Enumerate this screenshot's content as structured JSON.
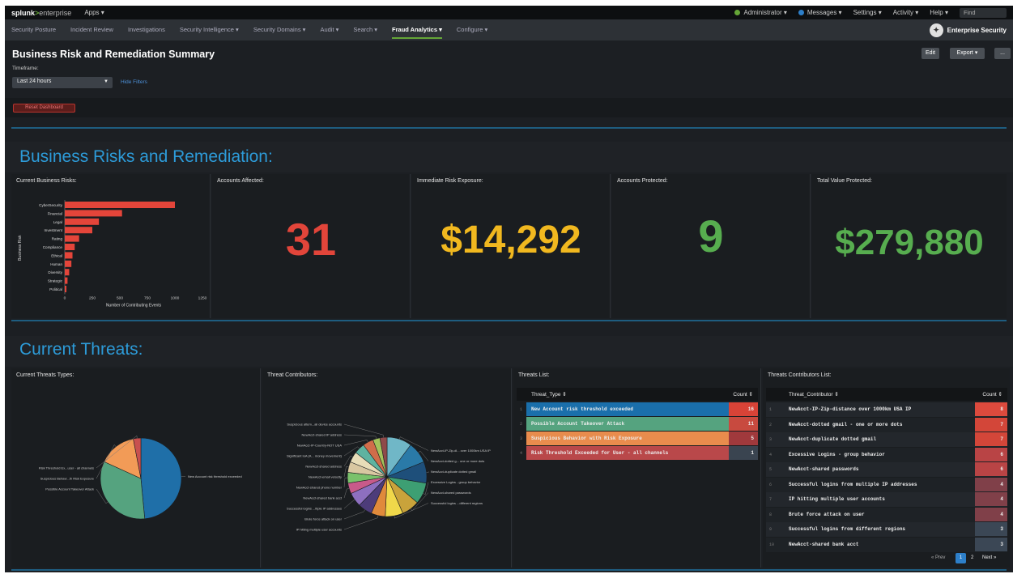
{
  "topbar": {
    "logo": "splunk",
    "logo_gt": ">",
    "logo_suffix": "enterprise",
    "apps": "Apps ▾",
    "administrator": "Administrator ▾",
    "messages": "Messages ▾",
    "settings": "Settings ▾",
    "activity": "Activity ▾",
    "help": "Help ▾",
    "find_placeholder": "Find"
  },
  "nav": {
    "items": [
      {
        "label": "Security Posture"
      },
      {
        "label": "Incident Review"
      },
      {
        "label": "Investigations"
      },
      {
        "label": "Security Intelligence ▾"
      },
      {
        "label": "Security Domains ▾"
      },
      {
        "label": "Audit ▾"
      },
      {
        "label": "Search ▾"
      },
      {
        "label": "Fraud Analytics ▾"
      },
      {
        "label": "Configure ▾"
      }
    ],
    "active_index": 7,
    "app_name": "Enterprise Security"
  },
  "header": {
    "title": "Business Risk and Remediation Summary",
    "timeframe_label": "Timeframe:",
    "timeframe_value": "Last 24 hours",
    "hide_filters": "Hide Filters",
    "edit": "Edit",
    "export": "Export ▾",
    "more": "..."
  },
  "reset_button": "Reset Dashboard",
  "section1": {
    "title": "Business Risks and Remediation:",
    "risk_chart_title": "Current Business Risks:",
    "accounts_affected_title": "Accounts Affected:",
    "accounts_affected": "31",
    "risk_exposure_title": "Immediate Risk Exposure:",
    "risk_exposure": "$14,292",
    "accounts_protected_title": "Accounts Protected:",
    "accounts_protected": "9",
    "value_protected_title": "Total Value Protected:",
    "value_protected": "$279,880"
  },
  "chart_data": [
    {
      "type": "bar",
      "orientation": "horizontal",
      "categories": [
        "CyberSecurity",
        "Financial",
        "Legal",
        "Investment",
        "Rating",
        "Compliance",
        "Ethical",
        "Human",
        "Diversity",
        "Strategic",
        "Political"
      ],
      "values": [
        1000,
        520,
        310,
        250,
        130,
        90,
        70,
        60,
        40,
        25,
        15
      ],
      "xlabel": "Number of Contributing Events",
      "ylabel": "Business Risk",
      "xticks": [
        "0",
        "250",
        "500",
        "750",
        "1000",
        "1250"
      ],
      "xlim": [
        0,
        1250
      ],
      "color": "#e4453a"
    },
    {
      "type": "pie",
      "title": "Current Threats Types:",
      "labels": [
        "New Account risk threshold exceeded",
        "Possible Account Takeover Attack",
        "Suspicious Behavi...th Risk Exposure",
        "Risk Threshold Ex...user - all channels"
      ],
      "values": [
        16,
        11,
        5,
        1
      ],
      "colors": [
        "#1f6fa8",
        "#55a37f",
        "#f29b57",
        "#c8504f"
      ]
    },
    {
      "type": "pie",
      "title": "Threat Contributors:",
      "labels": [
        "NewAcct-IP-Zip-dl... over 1000km USA IP",
        "NewAcct-dotted g... one or more dots",
        "NewAcct-duplicate dotted gmail",
        "Excessive Logins - group behavior",
        "NewAcct-shared passwords",
        "Successful logins ...different regions",
        "IP hitting multiple user accounts",
        "Brute force attack on user",
        "Successful logins ...ltiple IP addresses",
        "NewAcct-shared bank acct",
        "NewAcct-shared phone number",
        "NewAcct-email velocity",
        "NewAcct-shared address",
        "Significant IoA (A... money movement)",
        "NewAcct-IP-Country-NOT USA",
        "NewAcct-shared IP address",
        "Suspicious attem...all device accounts"
      ],
      "values": [
        7,
        6,
        6,
        6,
        5,
        5,
        4,
        4,
        4,
        3,
        3,
        3,
        3,
        3,
        3,
        2,
        2
      ],
      "colors": [
        "#70b7c7",
        "#2a7aa8",
        "#1e4f7a",
        "#3d9f73",
        "#c9a33b",
        "#f0d84a",
        "#e08a3b",
        "#4d3c7a",
        "#8d6fbf",
        "#c85a8a",
        "#7ac16b",
        "#d9c7a1",
        "#e8ddb8",
        "#5fb3a0",
        "#d16d4a",
        "#a4c35b",
        "#8f4a4a"
      ]
    }
  ],
  "section2": {
    "title": "Current Threats:",
    "threats_list_title": "Threats List:",
    "contrib_list_title": "Threats Contributors List:"
  },
  "threats_table": {
    "col1": "Threat_Type ⇕",
    "col2": "Count ⇕",
    "rows": [
      {
        "idx": "1",
        "name": "New Account risk threshold exceeded",
        "count": "16",
        "row_color": "#1a6fab",
        "count_color": "#d84337"
      },
      {
        "idx": "2",
        "name": "Possible Account Takeover Attack",
        "count": "11",
        "row_color": "#55a37f",
        "count_color": "#c84a3f"
      },
      {
        "idx": "3",
        "name": "Suspicious Behavior with Risk Exposure",
        "count": "5",
        "row_color": "#e98c4d",
        "count_color": "#a0393c"
      },
      {
        "idx": "4",
        "name": "Risk Threshold Exceeded for User - all channels",
        "count": "1",
        "row_color": "#b9484a",
        "count_color": "#3a4450"
      }
    ]
  },
  "contrib_table": {
    "col1": "Threat_Contributor ⇕",
    "col2": "Count ⇕",
    "rows": [
      {
        "idx": "1",
        "name": "NewAcct-IP-Zip-distance over 1000km USA IP",
        "count": "8",
        "count_color": "#dc4a3d"
      },
      {
        "idx": "2",
        "name": "NewAcct-dotted gmail - one or more dots",
        "count": "7",
        "count_color": "#d34639"
      },
      {
        "idx": "3",
        "name": "NewAcct-duplicate dotted gmail",
        "count": "7",
        "count_color": "#d34639"
      },
      {
        "idx": "4",
        "name": "Excessive Logins - group behavior",
        "count": "6",
        "count_color": "#b94445"
      },
      {
        "idx": "5",
        "name": "NewAcct-shared passwords",
        "count": "6",
        "count_color": "#b94445"
      },
      {
        "idx": "6",
        "name": "Successful logins from multiple IP addresses",
        "count": "4",
        "count_color": "#804049"
      },
      {
        "idx": "7",
        "name": "IP hitting multiple user accounts",
        "count": "4",
        "count_color": "#804049"
      },
      {
        "idx": "8",
        "name": "Brute force attack on user",
        "count": "4",
        "count_color": "#804049"
      },
      {
        "idx": "9",
        "name": "Successful logins from different regions",
        "count": "3",
        "count_color": "#3b4755"
      },
      {
        "idx": "10",
        "name": "NewAcct-shared bank acct",
        "count": "3",
        "count_color": "#3b4755"
      }
    ],
    "pager_prev": "« Prev",
    "pager_page1": "1",
    "pager_page2": "2",
    "pager_next": "Next »"
  }
}
